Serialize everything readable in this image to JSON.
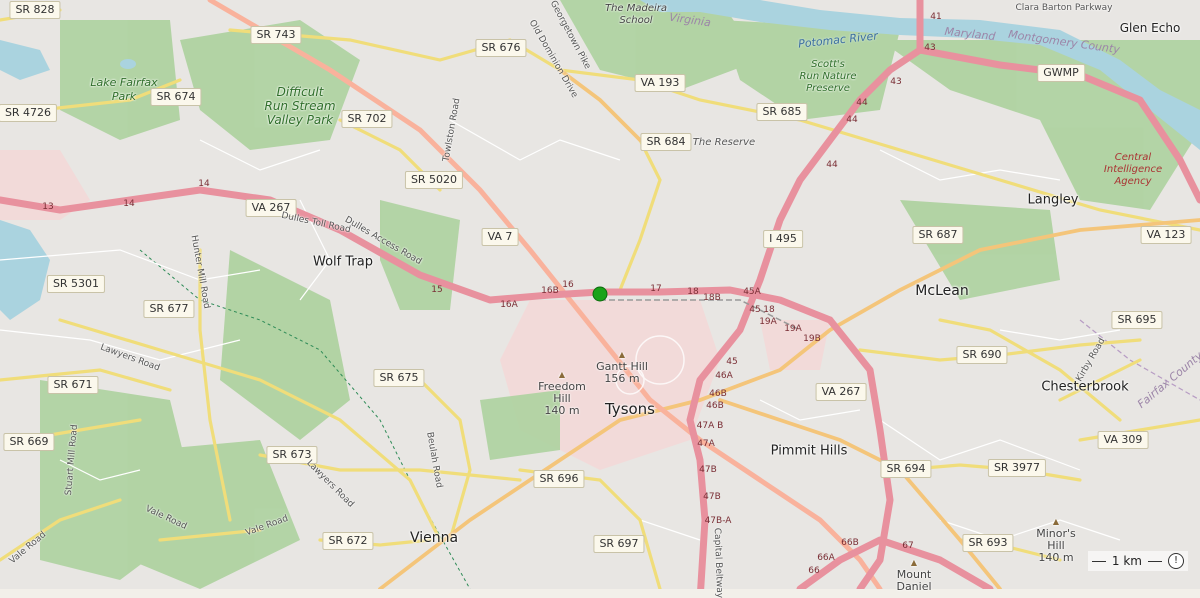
{
  "places": [
    {
      "id": "tysons",
      "label": "Tysons"
    },
    {
      "id": "mclean",
      "label": "McLean"
    },
    {
      "id": "vienna",
      "label": "Vienna"
    },
    {
      "id": "wolf-trap",
      "label": "Wolf Trap"
    },
    {
      "id": "langley",
      "label": "Langley"
    },
    {
      "id": "chesterbrook",
      "label": "Chesterbrook"
    },
    {
      "id": "pimmit-hills",
      "label": "Pimmit Hills"
    },
    {
      "id": "glen-echo",
      "label": "Glen Echo"
    }
  ],
  "parks": [
    {
      "id": "lake-fairfax",
      "label": "Lake Fairfax\nPark"
    },
    {
      "id": "difficult-run",
      "label": "Difficult\nRun Stream\nValley Park"
    },
    {
      "id": "scotts-run",
      "label": "Scott's\nRun Nature\nPreserve"
    },
    {
      "id": "madeira",
      "label": "The Madeira\nSchool"
    },
    {
      "id": "the-reserve",
      "label": "The Reserve"
    }
  ],
  "institutions": [
    {
      "id": "cia",
      "label": "Central\nIntelligence\nAgency"
    }
  ],
  "water": [
    {
      "id": "potomac",
      "label": "Potomac River"
    }
  ],
  "boundaries": [
    {
      "id": "virginia",
      "label": "Virginia"
    },
    {
      "id": "maryland",
      "label": "Maryland"
    },
    {
      "id": "montgomery",
      "label": "Montgomery County"
    },
    {
      "id": "fairfax",
      "label": "Fairfax County"
    }
  ],
  "peaks": [
    {
      "id": "gantt-hill",
      "label": "Gantt Hill\n156 m"
    },
    {
      "id": "freedom-hill",
      "label": "Freedom\nHill\n140 m"
    },
    {
      "id": "minors-hill",
      "label": "Minor's\nHill\n140 m"
    },
    {
      "id": "mount-daniel",
      "label": "Mount\nDaniel"
    }
  ],
  "shields": [
    {
      "id": "sr828",
      "label": "SR 828"
    },
    {
      "id": "sr743",
      "label": "SR 743"
    },
    {
      "id": "sr676",
      "label": "SR 676"
    },
    {
      "id": "va193",
      "label": "VA 193"
    },
    {
      "id": "sr685",
      "label": "SR 685"
    },
    {
      "id": "sr4726",
      "label": "SR 4726"
    },
    {
      "id": "sr674",
      "label": "SR 674"
    },
    {
      "id": "sr702",
      "label": "SR 702"
    },
    {
      "id": "sr684",
      "label": "SR 684"
    },
    {
      "id": "sr5020",
      "label": "SR 5020"
    },
    {
      "id": "va267a",
      "label": "VA 267"
    },
    {
      "id": "va7",
      "label": "VA 7"
    },
    {
      "id": "i495",
      "label": "I 495"
    },
    {
      "id": "sr687",
      "label": "SR 687"
    },
    {
      "id": "va123",
      "label": "VA 123"
    },
    {
      "id": "gwmp",
      "label": "GWMP"
    },
    {
      "id": "sr5301",
      "label": "SR 5301"
    },
    {
      "id": "sr677",
      "label": "SR 677"
    },
    {
      "id": "sr695",
      "label": "SR 695"
    },
    {
      "id": "sr690",
      "label": "SR 690"
    },
    {
      "id": "sr675",
      "label": "SR 675"
    },
    {
      "id": "sr671",
      "label": "SR 671"
    },
    {
      "id": "va267b",
      "label": "VA 267"
    },
    {
      "id": "sr669",
      "label": "SR 669"
    },
    {
      "id": "va309",
      "label": "VA 309"
    },
    {
      "id": "sr673",
      "label": "SR 673"
    },
    {
      "id": "sr694",
      "label": "SR 694"
    },
    {
      "id": "sr3977",
      "label": "SR 3977"
    },
    {
      "id": "sr696",
      "label": "SR 696"
    },
    {
      "id": "sr697",
      "label": "SR 697"
    },
    {
      "id": "sr672",
      "label": "SR 672"
    },
    {
      "id": "sr693",
      "label": "SR 693"
    }
  ],
  "road_names": [
    {
      "id": "georgetown-pike",
      "label": "Georgetown Pike"
    },
    {
      "id": "old-dominion",
      "label": "Old Dominion Drive"
    },
    {
      "id": "towlston",
      "label": "Towlston Road"
    },
    {
      "id": "dulles-toll",
      "label": "Dulles Toll Road"
    },
    {
      "id": "dulles-access",
      "label": "Dulles Access Road"
    },
    {
      "id": "hunter-mill",
      "label": "Hunter Mill Road"
    },
    {
      "id": "lawyers-road-1",
      "label": "Lawyers Road"
    },
    {
      "id": "lawyers-road-2",
      "label": "Lawyers Road"
    },
    {
      "id": "beulah",
      "label": "Beulah Road"
    },
    {
      "id": "stuart-mill",
      "label": "Stuart Mill Road"
    },
    {
      "id": "vale-road-1",
      "label": "Vale Road"
    },
    {
      "id": "vale-road-2",
      "label": "Vale Road"
    },
    {
      "id": "vale-road-3",
      "label": "Vale Road"
    },
    {
      "id": "kirby",
      "label": "Kirby Road"
    },
    {
      "id": "clara-barton",
      "label": "Clara Barton Parkway"
    },
    {
      "id": "capital-beltway",
      "label": "Capital Beltway"
    }
  ],
  "exits": [
    "13",
    "14",
    "14",
    "15",
    "16A",
    "16B",
    "16",
    "17",
    "18",
    "18B",
    "45A",
    "45",
    "18",
    "19A",
    "19A",
    "19B",
    "45",
    "46A",
    "46B",
    "46B",
    "47A B",
    "47A",
    "47B",
    "47B",
    "47B-A",
    "66A",
    "66B",
    "66",
    "67",
    "43",
    "43",
    "41",
    "44",
    "44",
    "44"
  ],
  "scale": {
    "label": "1 km"
  },
  "colors": {
    "motorway": "#e8919e",
    "trunk": "#f9b29c",
    "primary": "#fcd6a4",
    "secondary": "#f7fabf",
    "forest": "#add19e",
    "water": "#aad3df",
    "residential": "#e0dfdf",
    "commercial": "#f2dad9",
    "marker": "#1aa31a"
  }
}
